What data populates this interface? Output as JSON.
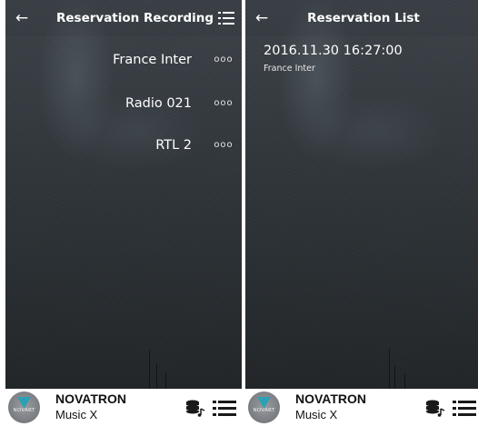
{
  "left_panel": {
    "title": "Reservation Recording",
    "back_icon": "arrow-left-icon",
    "list_icon": "list-icon",
    "stations": [
      {
        "name": "France Inter",
        "more": "ooo"
      },
      {
        "name": "Radio 021",
        "more": "ooo"
      },
      {
        "name": "RTL 2",
        "more": "ooo"
      }
    ]
  },
  "right_panel": {
    "title": "Reservation List",
    "back_icon": "arrow-left-icon",
    "reservations": [
      {
        "datetime": "2016.11.30 16:27:00",
        "station": "France Inter"
      }
    ]
  },
  "player": {
    "logo_text": "NOVART",
    "title": "NOVATRON",
    "subtitle": "Music X",
    "icons": [
      "database-music-icon",
      "playlist-icon"
    ]
  },
  "colors": {
    "background_dark": "#2f3439",
    "text_light": "#ffffff",
    "player_bg": "#ffffff",
    "logo_teal": "#2ea0b5"
  }
}
